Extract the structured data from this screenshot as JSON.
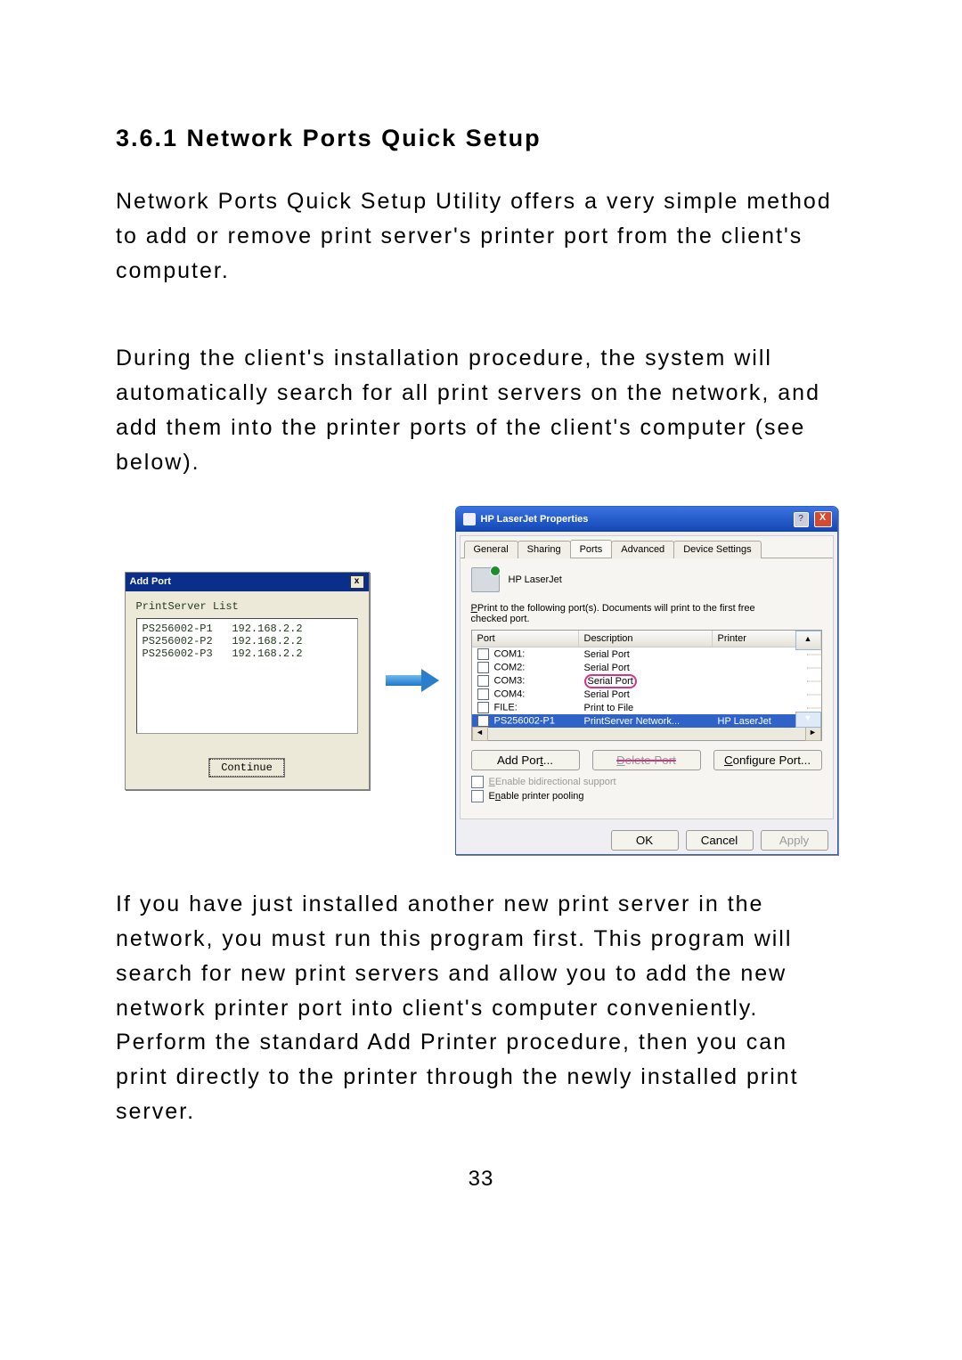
{
  "heading": "3.6.1    Network Ports Quick Setup",
  "para1": " Network Ports Quick Setup Utility offers a very simple method to add or remove print server's printer port from the client's computer.",
  "para2": "During the client's installation procedure, the system will automatically search for all print servers on the network, and add them into the printer ports of the client's computer (see below).",
  "para3": "If you have just installed another new print server in the network, you must run this program first. This program will search for new print servers and allow you to add the new network printer port into client's computer conveniently. Perform the standard Add Printer procedure, then you can print directly to the printer through the newly installed print server.",
  "pagenum": "33",
  "addport": {
    "title": "Add Port",
    "close": "x",
    "list_label": "PrintServer List",
    "rows": [
      "PS256002-P1   192.168.2.2",
      "PS256002-P2   192.168.2.2",
      "PS256002-P3   192.168.2.2"
    ],
    "continue": "Continue"
  },
  "props": {
    "title": "HP LaserJet Properties",
    "help": "?",
    "close": "X",
    "tabs": [
      "General",
      "Sharing",
      "Ports",
      "Advanced",
      "Device Settings"
    ],
    "active_tab": 2,
    "printer_name": "HP LaserJet",
    "instruction_a": "Print to the following port(s). Documents will print to the first free",
    "instruction_b": "checked port.",
    "cols": [
      "Port",
      "Description",
      "Printer"
    ],
    "rows": [
      {
        "checked": false,
        "port": "COM1:",
        "desc": "Serial Port",
        "printer": ""
      },
      {
        "checked": false,
        "port": "COM2:",
        "desc": "Serial Port",
        "printer": ""
      },
      {
        "checked": false,
        "port": "COM3:",
        "desc": "Serial Port",
        "printer": ""
      },
      {
        "checked": false,
        "port": "COM4:",
        "desc": "Serial Port",
        "printer": ""
      },
      {
        "checked": false,
        "port": "FILE:",
        "desc": "Print to File",
        "printer": ""
      },
      {
        "checked": true,
        "port": "PS256002-P1",
        "desc": "PrintServer Network...",
        "printer": "HP LaserJet"
      }
    ],
    "btn_add": "Add Port...",
    "btn_del": "Delete Port",
    "btn_cfg": "Configure Port...",
    "chk_bidi": "Enable bidirectional support",
    "chk_pool": "Enable printer pooling",
    "ok": "OK",
    "cancel": "Cancel",
    "apply": "Apply"
  }
}
